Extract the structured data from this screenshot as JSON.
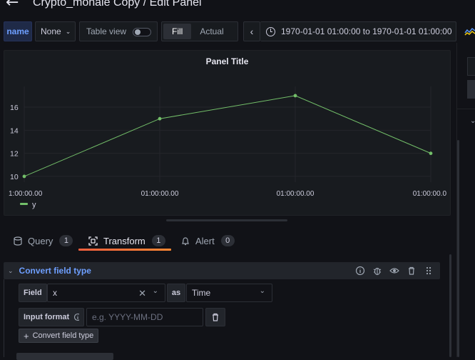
{
  "header": {
    "title": "Crypto_monale Copy / Edit Panel"
  },
  "toolbar": {
    "variable_name": "name",
    "variable_value": "None",
    "table_view_label": "Table view",
    "fill_label": "Fill",
    "actual_label": "Actual",
    "time_range": "1970-01-01 01:00:00 to 1970-01-01 01:00:00"
  },
  "panel": {
    "title": "Panel Title",
    "legend": "y"
  },
  "chart_data": {
    "type": "line",
    "x": [
      "01:00:00.00",
      "01:00:00.00",
      "01:00:00.00",
      "01:00:00.00"
    ],
    "x_tick_labels": [
      "1:00:00.00",
      "01:00:00.00",
      "01:00:00.00",
      "01:00:00.0"
    ],
    "series": [
      {
        "name": "y",
        "values": [
          10,
          15,
          17,
          12
        ],
        "color": "#73bf69"
      }
    ],
    "y_ticks": [
      10,
      12,
      14,
      16
    ],
    "ylim": [
      9.5,
      17.8
    ],
    "grid": true,
    "legend_position": "bottom-left"
  },
  "tabs": [
    {
      "label": "Query",
      "count": "1",
      "icon": "database-icon"
    },
    {
      "label": "Transform",
      "count": "1",
      "icon": "transform-icon",
      "active": true
    },
    {
      "label": "Alert",
      "count": "0",
      "icon": "bell-icon"
    }
  ],
  "transform": {
    "title": "Convert field type",
    "field_label": "Field",
    "field_value": "x",
    "as_label": "as",
    "type_value": "Time",
    "input_format_label": "Input format",
    "input_format_placeholder": "e.g. YYYY-MM-DD",
    "add_button": "Convert field type"
  },
  "colors": {
    "accent": "#6e9fff",
    "series": "#73bf69",
    "tab_active": "#f55f3e"
  }
}
